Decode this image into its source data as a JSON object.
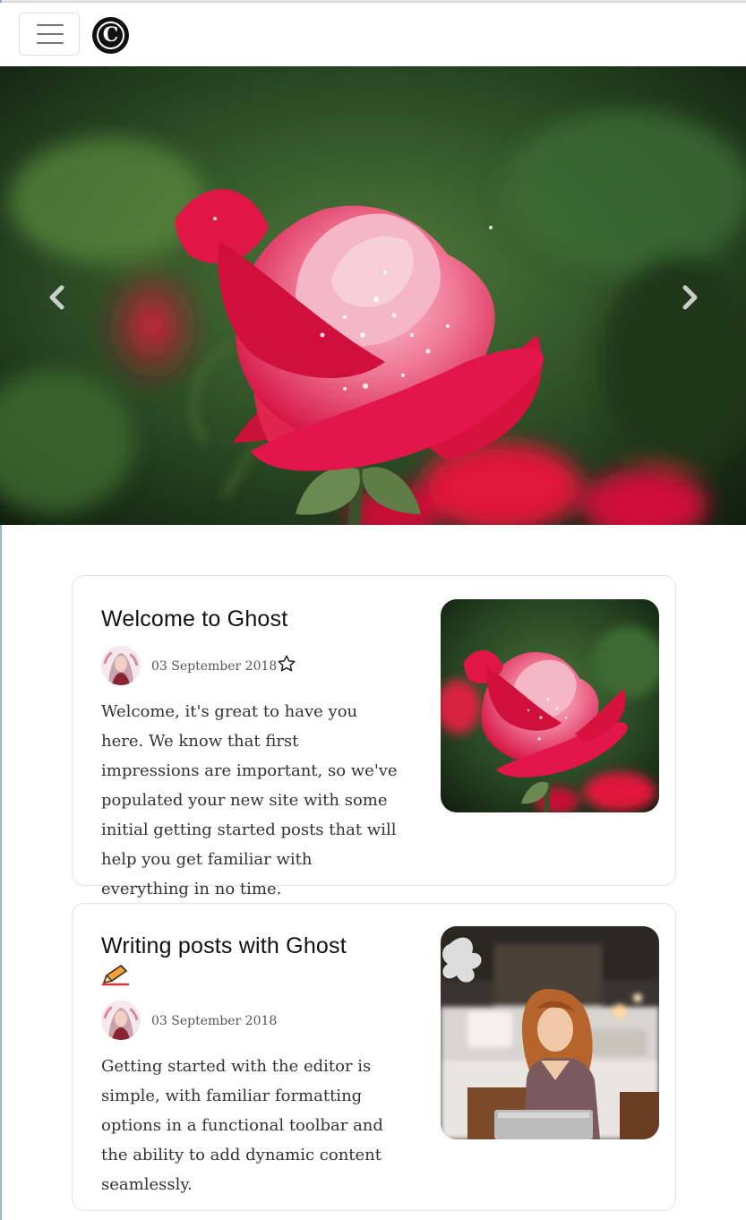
{
  "header": {
    "menu_icon": "hamburger-menu-icon",
    "logo_letter": "C"
  },
  "hero": {
    "prev_icon": "chevron-left-icon",
    "next_icon": "chevron-right-icon",
    "colors": {
      "rose": "#e3174a",
      "rose_light": "#f4a3b8",
      "foliage": "#2f5a2a"
    }
  },
  "posts": [
    {
      "title": "Welcome to Ghost",
      "date": "03 September 2018",
      "featured_icon": "star-outline-icon",
      "excerpt": "Welcome, it's great to have you here. We know that first impressions are important, so we've populated your new site with some initial getting started posts that will help you get familiar with everything in no time."
    },
    {
      "title": "Writing posts with Ghost",
      "title_icon": "writing-hand-emoji-icon",
      "date": "03 September 2018",
      "excerpt": "Getting started with the editor is simple, with familiar formatting options in a functional toolbar and the ability to add dynamic content seamlessly."
    }
  ]
}
